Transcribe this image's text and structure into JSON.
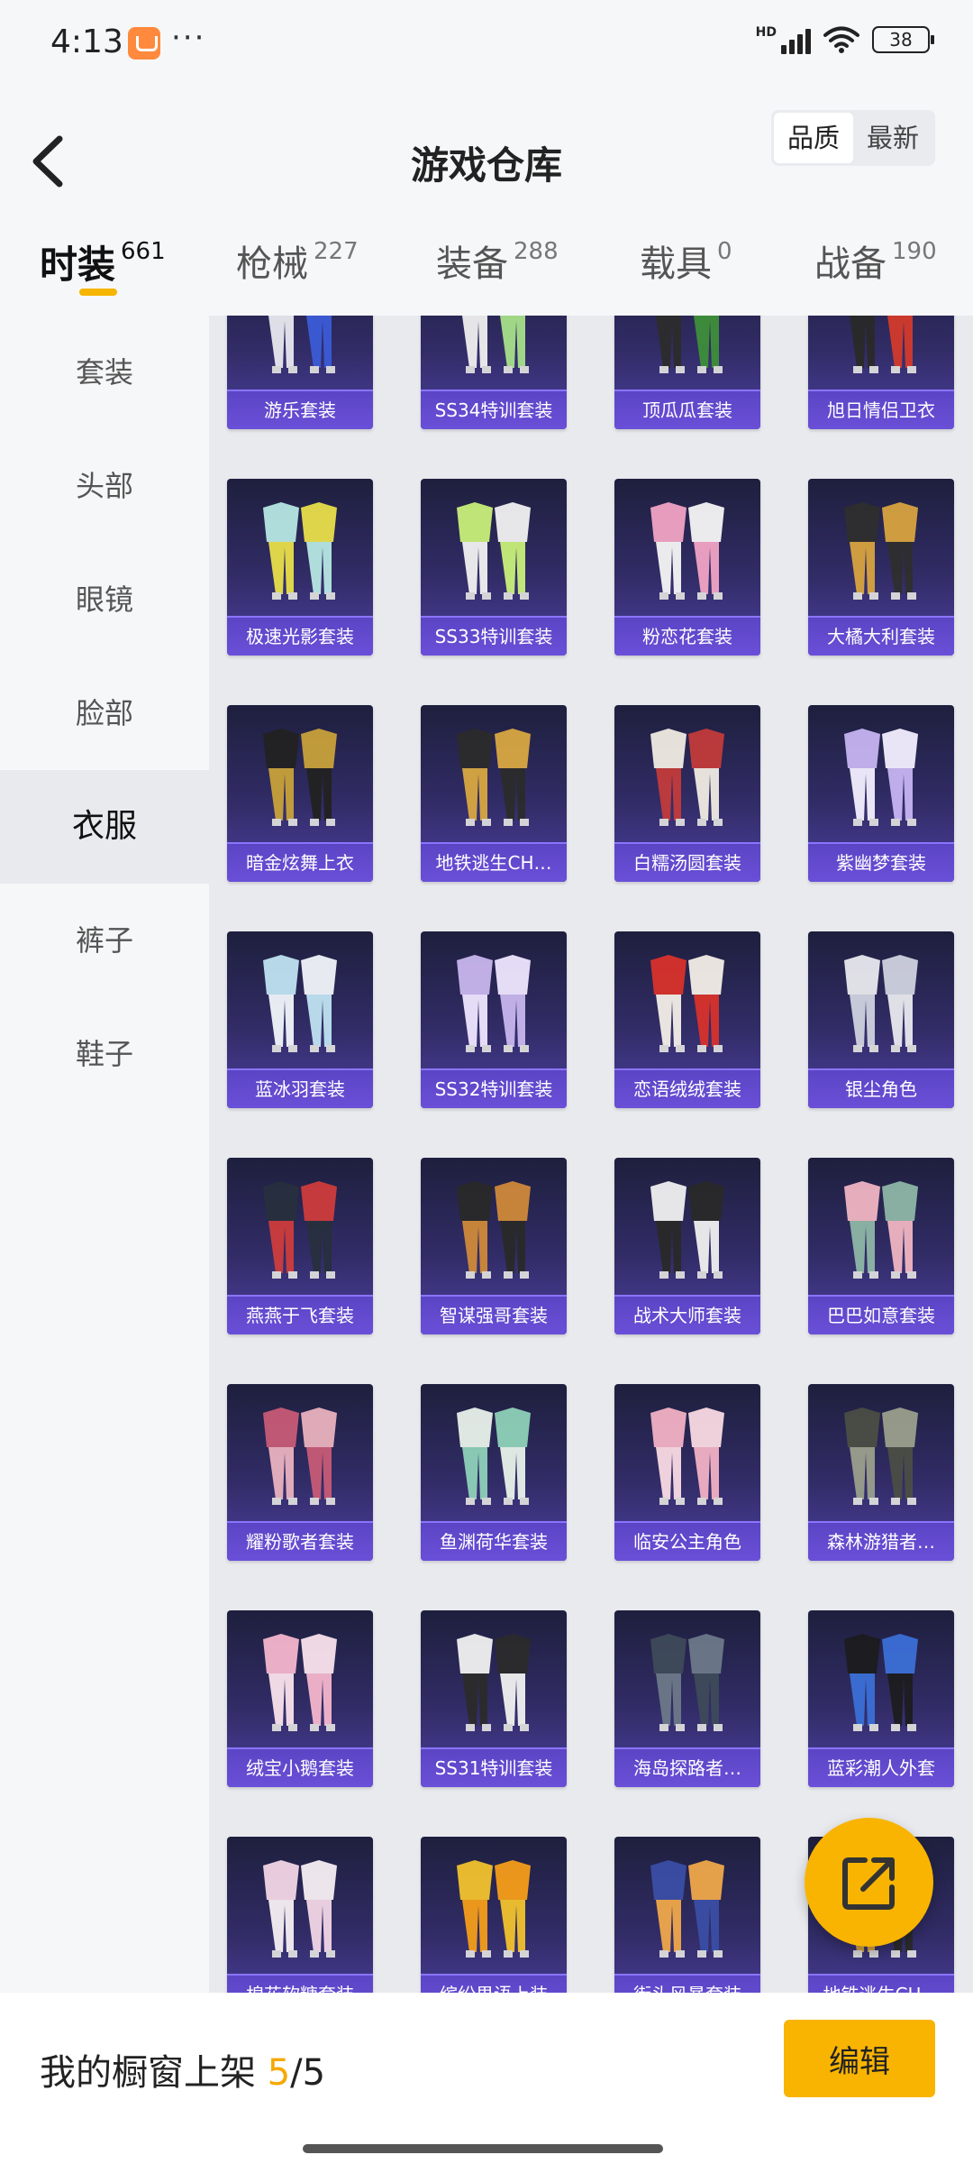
{
  "status_bar": {
    "time": "4:13",
    "more": "···",
    "network": "HD",
    "battery": "38"
  },
  "header": {
    "title": "游戏仓库",
    "sort_options": [
      "品质",
      "最新"
    ],
    "active_sort": "品质"
  },
  "tabs": [
    {
      "label": "时装",
      "count": "661",
      "active": true
    },
    {
      "label": "枪械",
      "count": "227"
    },
    {
      "label": "装备",
      "count": "288"
    },
    {
      "label": "载具",
      "count": "0"
    },
    {
      "label": "战备",
      "count": "190"
    }
  ],
  "sidebar": {
    "items": [
      "套装",
      "头部",
      "眼镜",
      "脸部",
      "衣服",
      "裤子",
      "鞋子"
    ],
    "active": "衣服"
  },
  "items": [
    "游乐套装",
    "SS34特训套装",
    "顶瓜瓜套装",
    "旭日情侣卫衣",
    "极速光影套装",
    "SS33特训套装",
    "粉恋花套装",
    "大橘大利套装",
    "暗金炫舞上衣",
    "地铁逃生CH…",
    "白糯汤圆套装",
    "紫幽梦套装",
    "蓝冰羽套装",
    "SS32特训套装",
    "恋语绒绒套装",
    "银尘角色",
    "燕燕于飞套装",
    "智谋强哥套装",
    "战术大师套装",
    "巴巴如意套装",
    "耀粉歌者套装",
    "鱼渊荷华套装",
    "临安公主角色",
    "森林游猎者…",
    "绒宝小鹅套装",
    "SS31特训套装",
    "海岛探路者…",
    "蓝彩潮人外套",
    "棉花软糖套装",
    "缤纷果语上装",
    "街头风暴套装",
    "地铁逃生CH…"
  ],
  "bottom_bar": {
    "shelf_label": "我的橱窗上架",
    "shelf_current": "5",
    "shelf_total": "/5",
    "edit_label": "编辑"
  },
  "colors": {
    "accent": "#f8b400",
    "card_label": "#6a4fd8",
    "card_bg": "#312c66"
  }
}
